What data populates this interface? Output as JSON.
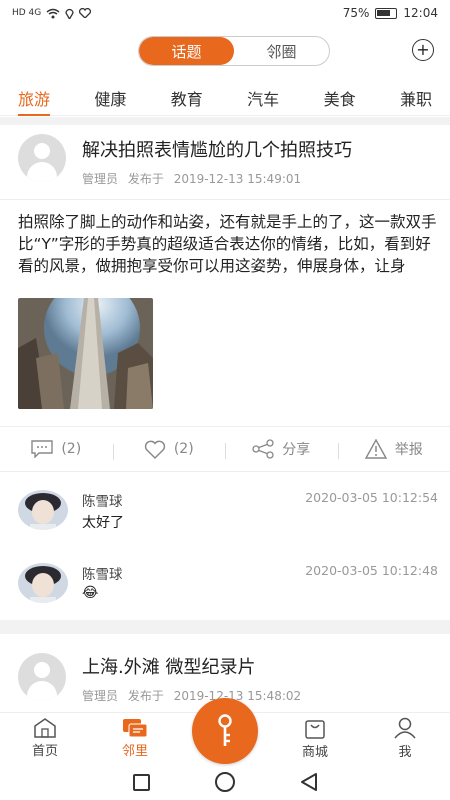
{
  "status_bar": {
    "left_indicators": "HD 4G",
    "battery": "75%",
    "time": "12:04"
  },
  "header": {
    "segment_active": "话题",
    "segment_inactive": "邻圈"
  },
  "tabs": [
    "旅游",
    "健康",
    "教育",
    "汽车",
    "美食",
    "兼职"
  ],
  "posts": [
    {
      "title": "解决拍照表情尴尬的几个拍照技巧",
      "author": "管理员",
      "published_label": "发布于",
      "date": "2019-12-13 15:49:01",
      "content": "拍照除了脚上的动作和站姿，还有就是手上的了，这一款双手比“Y”字形的手势真的超级适合表达你的情绪，比如，看到好看的风景，做拥抱享受你可以用这姿势，伸展身体，让身",
      "comment_count": "(2)",
      "like_count": "(2)",
      "share_label": "分享",
      "report_label": "举报",
      "comments": [
        {
          "name": "陈雪球",
          "time": "2020-03-05 10:12:54",
          "text": "太好了"
        },
        {
          "name": "陈雪球",
          "time": "2020-03-05 10:12:48",
          "text": "😂"
        }
      ]
    },
    {
      "title": "上海.外滩 微型纪录片",
      "author": "管理员",
      "published_label": "发布于",
      "date": "2019-12-13 15:48:02"
    }
  ],
  "bottom_nav": [
    {
      "label": "首页",
      "icon": "home-icon"
    },
    {
      "label": "邻里",
      "icon": "chat-icon"
    },
    {
      "label": "",
      "icon": "key-icon"
    },
    {
      "label": "商城",
      "icon": "shop-bag-icon"
    },
    {
      "label": "我",
      "icon": "user-icon"
    }
  ],
  "colors": {
    "accent": "#e8681e"
  }
}
